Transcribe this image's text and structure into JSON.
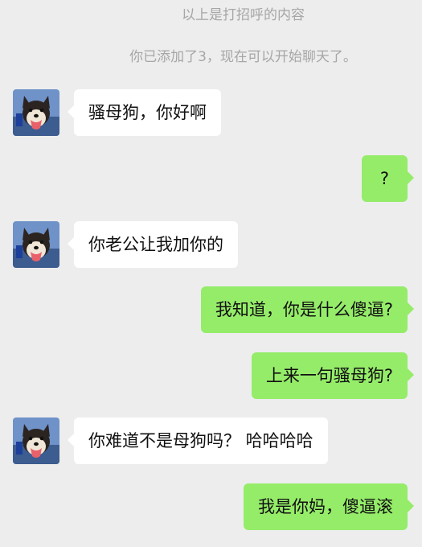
{
  "system": {
    "greeting_note": "以上是打招呼的内容",
    "added_note": "你已添加了3，现在可以开始聊天了。"
  },
  "colors": {
    "background": "#ededed",
    "incoming_bubble": "#ffffff",
    "outgoing_bubble": "#95ec69",
    "system_text": "#a6a6a6"
  },
  "contact": {
    "avatar_icon": "shiba-dog-avatar-icon"
  },
  "messages": [
    {
      "side": "in",
      "text": "骚母狗，你好啊"
    },
    {
      "side": "out",
      "text": "?"
    },
    {
      "side": "in",
      "text": "你老公让我加你的"
    },
    {
      "side": "out",
      "text": "我知道，你是什么傻逼?"
    },
    {
      "side": "out",
      "text": "上来一句骚母狗?"
    },
    {
      "side": "in",
      "text": "你难道不是母狗吗？ 哈哈哈哈"
    },
    {
      "side": "out",
      "text": "我是你妈，傻逼滚"
    }
  ]
}
